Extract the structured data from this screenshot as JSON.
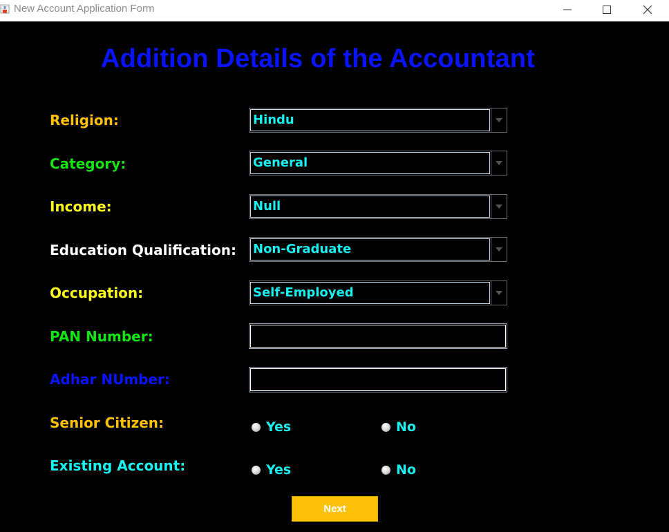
{
  "window": {
    "title": "New Account Application Form",
    "icon": "java-cup-icon"
  },
  "heading": "Addition Details of the Accountant",
  "fields": {
    "religion": {
      "label": "Religion:",
      "value": "Hindu",
      "label_color": "#ffc107"
    },
    "category": {
      "label": "Category:",
      "value": "General",
      "label_color": "#14e614"
    },
    "income": {
      "label": "Income:",
      "value": "Null",
      "label_color": "#ffff1e"
    },
    "education": {
      "label": "Education Qualification:",
      "value": "Non-Graduate",
      "label_color": "#ffffff"
    },
    "occupation": {
      "label": "Occupation:",
      "value": "Self-Employed",
      "label_color": "#ffff1e"
    },
    "pan": {
      "label": "PAN Number:",
      "value": "",
      "label_color": "#14e614"
    },
    "adhar": {
      "label": "Adhar NUmber:",
      "value": "",
      "label_color": "#0a13ff"
    },
    "senior_citizen": {
      "label": "Senior Citizen:",
      "options": [
        "Yes",
        "No"
      ],
      "label_color": "#ffc107"
    },
    "existing_account": {
      "label": "Existing Account:",
      "options": [
        "Yes",
        "No"
      ],
      "label_color": "#19f0f0"
    }
  },
  "next_button": "Next",
  "colors": {
    "background": "#000000",
    "heading": "#0a13ff",
    "value_text": "#19f0f0",
    "button": "#ffc107"
  }
}
